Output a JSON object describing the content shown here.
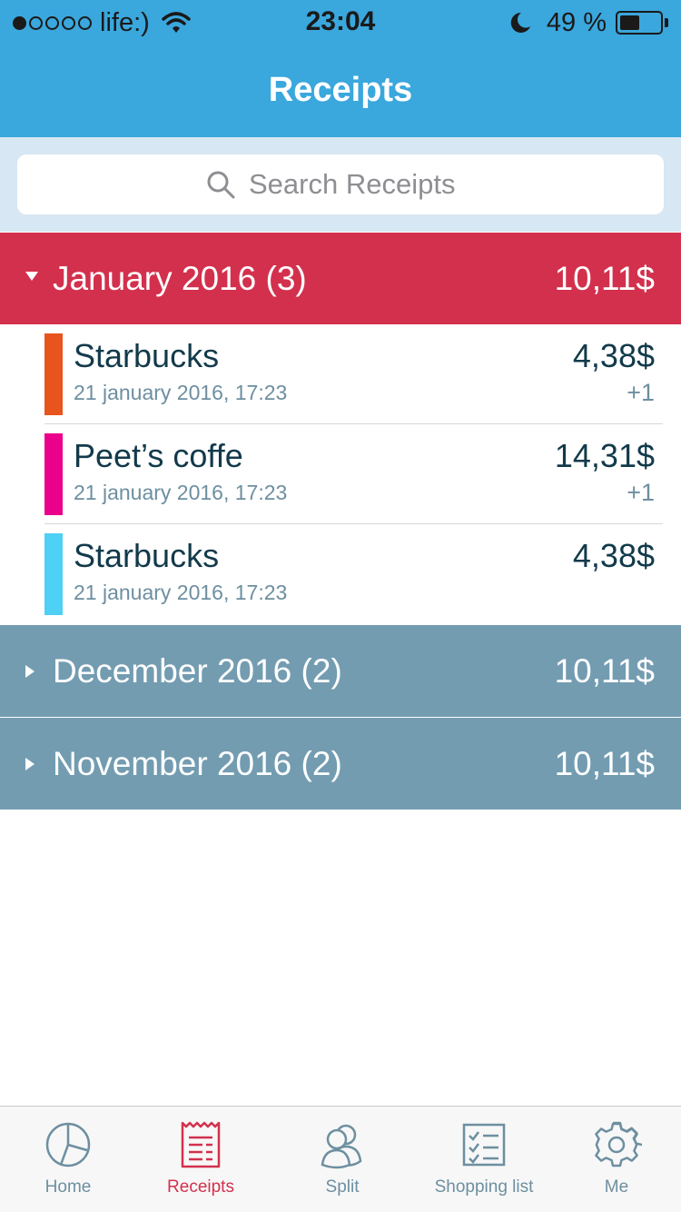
{
  "status_bar": {
    "signal_dots_filled": 1,
    "signal_dots_total": 5,
    "carrier": "life:)",
    "time": "23:04",
    "battery_percent_text": "49 %",
    "battery_level": 0.49
  },
  "nav": {
    "title": "Receipts"
  },
  "search": {
    "placeholder": "Search Receipts"
  },
  "groups": [
    {
      "title": "January 2016 (3)",
      "total": "10,11$",
      "expanded": true,
      "color": "#d3304d",
      "receipts": [
        {
          "name": "Starbucks",
          "date": "21 january 2016, 17:23",
          "amount": "4,38$",
          "extra": "+1",
          "color": "#e8541e"
        },
        {
          "name": "Peet’s coffe",
          "date": "21 january 2016, 17:23",
          "amount": "14,31$",
          "extra": "+1",
          "color": "#eb008b"
        },
        {
          "name": "Starbucks",
          "date": "21 january 2016, 17:23",
          "amount": "4,38$",
          "extra": "",
          "color": "#4fd0f5"
        }
      ]
    },
    {
      "title": "December 2016 (2)",
      "total": "10,11$",
      "expanded": false,
      "color": "#739cb1"
    },
    {
      "title": "November 2016 (2)",
      "total": "10,11$",
      "expanded": false,
      "color": "#739cb1"
    }
  ],
  "tabs": [
    {
      "label": "Home",
      "icon": "pie-chart-icon",
      "active": false
    },
    {
      "label": "Receipts",
      "icon": "receipt-icon",
      "active": true
    },
    {
      "label": "Split",
      "icon": "users-icon",
      "active": false
    },
    {
      "label": "Shopping list",
      "icon": "checklist-icon",
      "active": false
    },
    {
      "label": "Me",
      "icon": "gear-icon",
      "active": false
    }
  ],
  "colors": {
    "primary_blue": "#3aa7dd",
    "accent_red": "#d3304d",
    "collapsed_group": "#739cb1",
    "text_dark": "#123a4b",
    "text_muted": "#6d8fa0"
  }
}
